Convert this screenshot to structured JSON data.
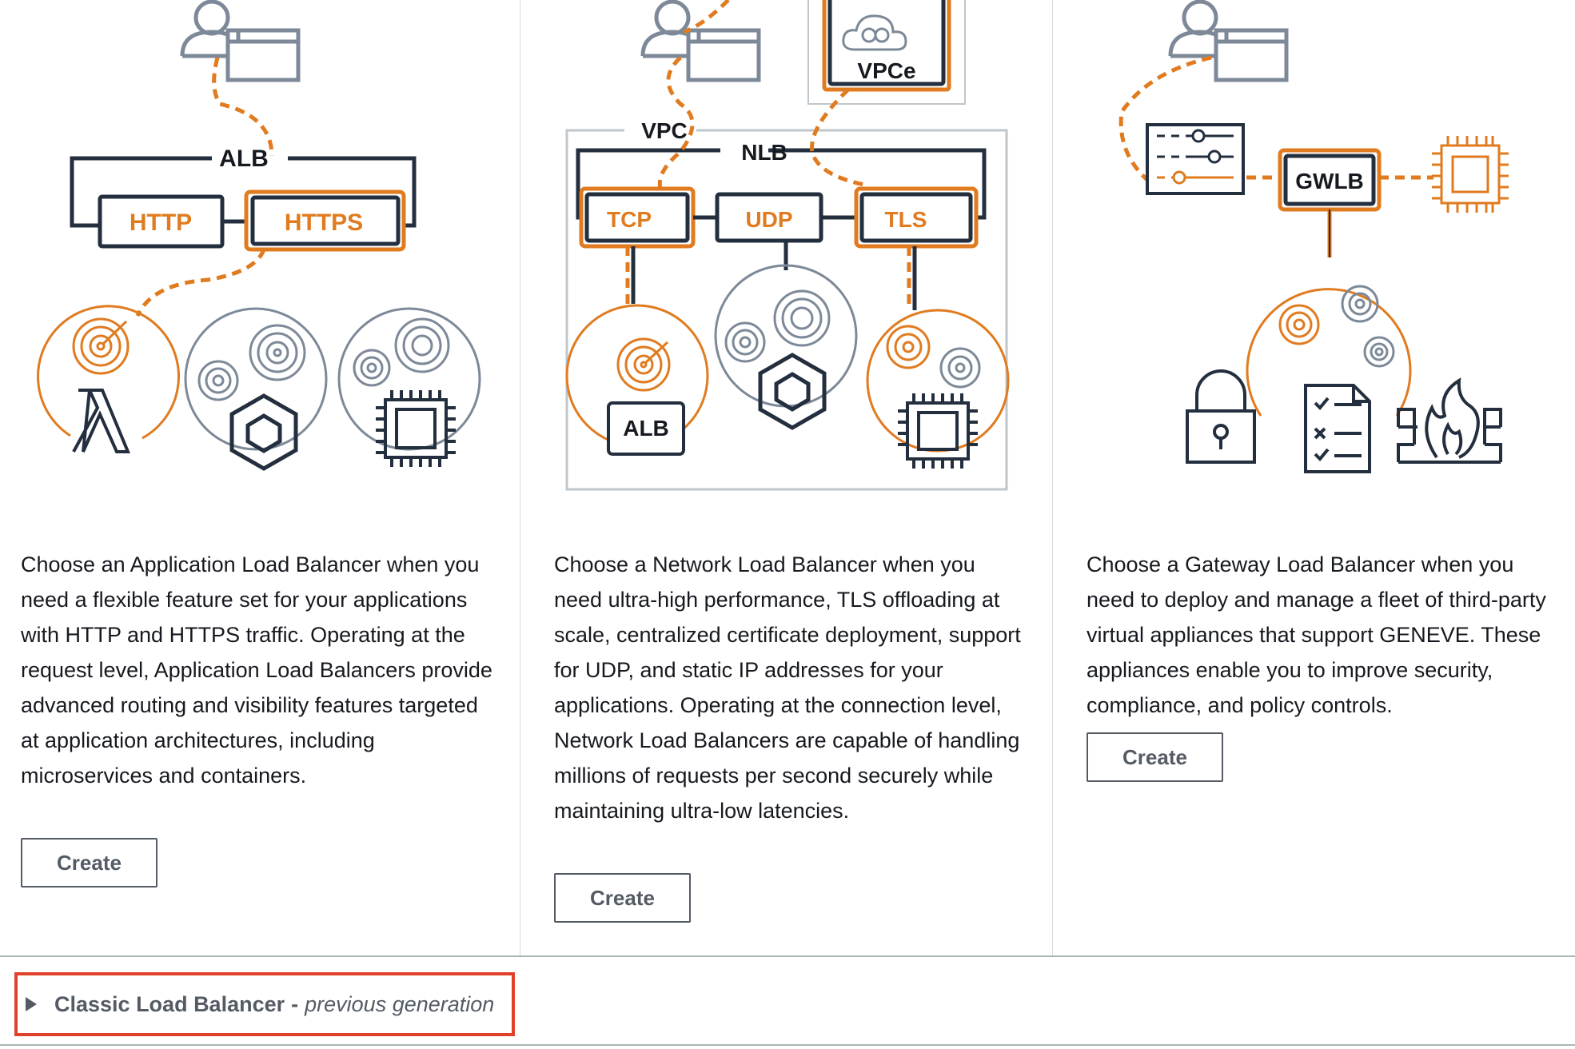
{
  "alb": {
    "diagram": {
      "group": "ALB",
      "listeners": [
        "HTTP",
        "HTTPS"
      ]
    },
    "description": "Choose an Application Load Balancer when you need a flexible feature set for your applications with HTTP and HTTPS traffic. Operating at the request level, Application Load Balancers provide advanced routing and visibility features targeted at application architectures, including microservices and containers.",
    "create_label": "Create"
  },
  "nlb": {
    "diagram": {
      "vpc": "VPC",
      "group": "NLB",
      "endpoint": "VPCe",
      "listeners": [
        "TCP",
        "UDP",
        "TLS"
      ],
      "target": "ALB"
    },
    "description": "Choose a Network Load Balancer when you need ultra-high performance, TLS offloading at scale, centralized certificate deployment, support for UDP, and static IP addresses for your applications. Operating at the connection level, Network Load Balancers are capable of handling millions of requests per second securely while maintaining ultra-low latencies.",
    "create_label": "Create"
  },
  "gwlb": {
    "diagram": {
      "group": "GWLB"
    },
    "description": "Choose a Gateway Load Balancer when you need to deploy and manage a fleet of third-party virtual appliances that support GENEVE. These appliances enable you to improve security, compliance, and policy controls.",
    "create_label": "Create"
  },
  "classic": {
    "title": "Classic Load Balancer",
    "separator": "-",
    "subtitle": "previous generation"
  },
  "colors": {
    "orange": "#e07b1f",
    "dark": "#232f3e",
    "gray": "#7d8998",
    "highlight": "#e0412a"
  },
  "icons": [
    "user-browser-icon",
    "lambda-icon",
    "container-icon",
    "chip-icon",
    "target-icon",
    "cloud-icon",
    "lock-icon",
    "checklist-icon",
    "firewall-icon",
    "sliders-icon"
  ]
}
